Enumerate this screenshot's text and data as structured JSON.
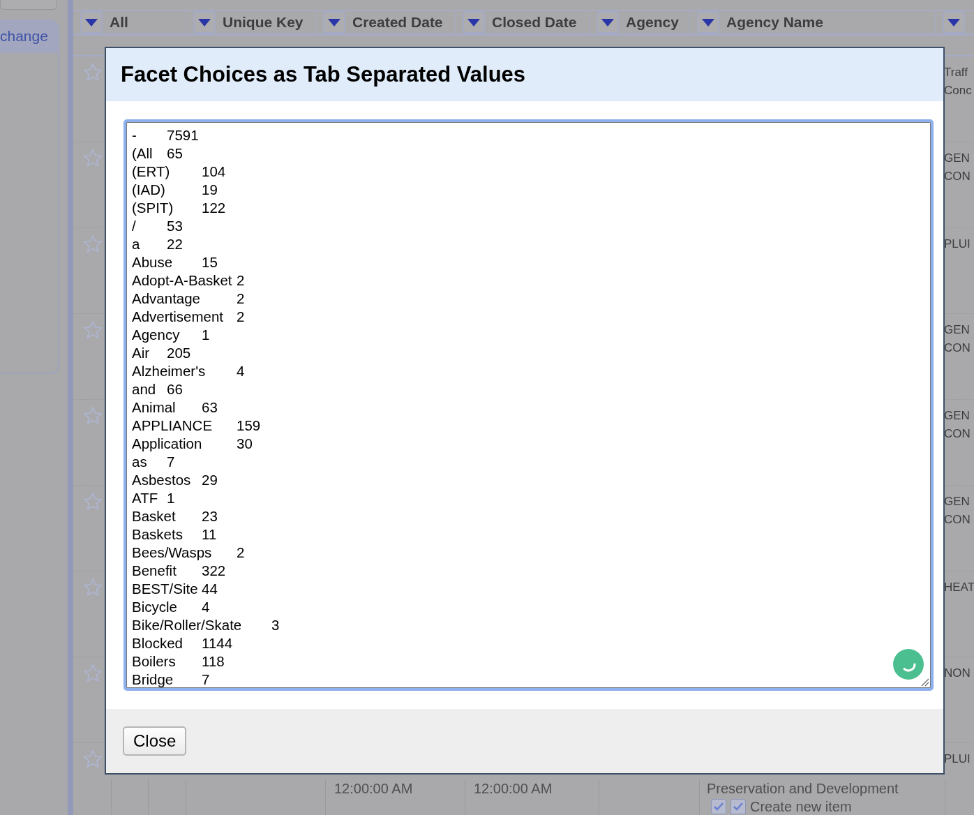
{
  "sidebar": {
    "tab": "change"
  },
  "table": {
    "columns": [
      {
        "label": "All"
      },
      {
        "label": "Unique Key"
      },
      {
        "label": "Created Date"
      },
      {
        "label": "Closed Date"
      },
      {
        "label": "Agency"
      },
      {
        "label": "Agency Name"
      },
      {}
    ],
    "rows": [
      {
        "starred": false,
        "column_7": [
          "Traff",
          "Conc"
        ]
      },
      {
        "starred": false,
        "column_7": [
          "GEN",
          "CON"
        ]
      },
      {
        "starred": false,
        "column_7": [
          "PLUI"
        ]
      },
      {
        "starred": false,
        "column_7": [
          "GEN",
          "CON"
        ]
      },
      {
        "starred": false,
        "column_7": [
          "GEN",
          "CON"
        ]
      },
      {
        "starred": false,
        "column_7": [
          "GEN",
          "CON"
        ]
      },
      {
        "starred": false,
        "column_7": [
          "HEAT"
        ]
      },
      {
        "starred": false,
        "column_7": [
          "NON"
        ]
      },
      {
        "starred": false,
        "column_7": [
          "PLUI"
        ],
        "created_date": "12:00:00 AM",
        "closed_date": "12:00:00 AM",
        "agency_name": "Preservation and Development",
        "checks": [
          {
            "checked": true
          },
          {
            "checked": true
          }
        ],
        "action": "Create new item"
      }
    ]
  },
  "dialog": {
    "title": "Facet Choices as Tab Separated Values",
    "lines": [
      "-\t7591",
      "(All\t65",
      "(ERT)\t104",
      "(IAD)\t19",
      "(SPIT)\t122",
      "/\t53",
      "a\t22",
      "Abuse\t15",
      "Adopt-A-Basket\t2",
      "Advantage\t2",
      "Advertisement\t2",
      "Agency\t1",
      "Air\t205",
      "Alzheimer's\t4",
      "and\t66",
      "Animal\t63",
      "APPLIANCE\t159",
      "Application\t30",
      "as\t7",
      "Asbestos\t29",
      "ATF\t1",
      "Basket\t23",
      "Baskets\t11",
      "Bees/Wasps\t2",
      "Benefit\t322",
      "BEST/Site\t44",
      "Bicycle\t4",
      "Bike/Roller/Skate\t3",
      "Blocked\t1144",
      "Boilers\t118",
      "Bridge\t7"
    ],
    "buttons": [
      "Close"
    ]
  }
}
